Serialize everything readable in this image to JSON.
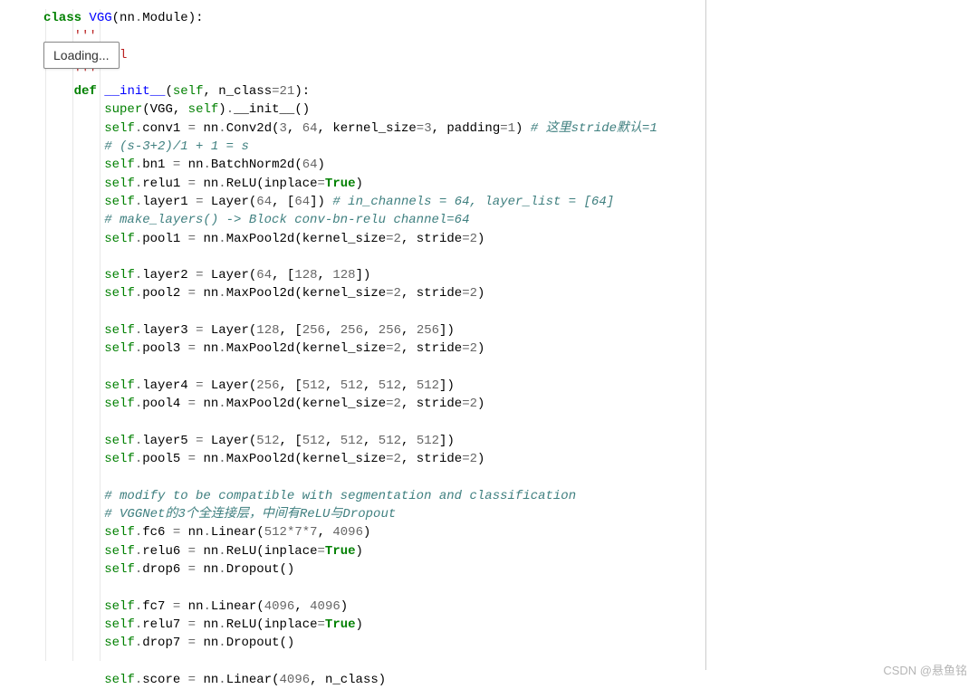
{
  "loading_label": "Loading...",
  "watermark": "CSDN @悬鱼铭",
  "code": {
    "class_kw": "class",
    "class_name": "VGG",
    "module_base": "nn",
    "module_cls": "Module",
    "docstring_open": "'''",
    "docstring_text": "del",
    "docstring_close": "'''",
    "def_kw": "def",
    "init_name": "__init__",
    "self": "self",
    "param_nclass": "n_class",
    "nclass_default": "21",
    "super_line_a": "super",
    "super_line_b": "VGG",
    "super_line_c": "self",
    "super_init": "__init__",
    "conv1_attr": "conv1",
    "nn": "nn",
    "Conv2d": "Conv2d",
    "c2d_a": "3",
    "c2d_b": "64",
    "ks_lbl": "kernel_size",
    "ks_v": "3",
    "pad_lbl": "padding",
    "pad_v": "1",
    "c1_comment": "# 这里stride默认=1",
    "c2_comment": "# (s-3+2)/1 + 1 = s",
    "bn1_attr": "bn1",
    "BatchNorm2d": "BatchNorm2d",
    "bn1_v": "64",
    "relu1_attr": "relu1",
    "ReLU": "ReLU",
    "inplace_lbl": "inplace",
    "true_kw": "True",
    "layer1_attr": "layer1",
    "Layer": "Layer",
    "l1_a": "64",
    "l1_b": "64",
    "l1_comment": "# in_channels = 64, layer_list = [64]",
    "ml_comment": "# make_layers() -> Block conv-bn-relu channel=64",
    "pool1_attr": "pool1",
    "MaxPool2d": "MaxPool2d",
    "p_ks_lbl": "kernel_size",
    "p_ks_v": "2",
    "stride_lbl": "stride",
    "stride_v": "2",
    "layer2_attr": "layer2",
    "l2_a": "64",
    "l2_b1": "128",
    "l2_b2": "128",
    "pool2_attr": "pool2",
    "layer3_attr": "layer3",
    "l3_a": "128",
    "l3_b1": "256",
    "l3_b2": "256",
    "l3_b3": "256",
    "l3_b4": "256",
    "pool3_attr": "pool3",
    "layer4_attr": "layer4",
    "l4_a": "256",
    "l4_b1": "512",
    "l4_b2": "512",
    "l4_b3": "512",
    "l4_b4": "512",
    "pool4_attr": "pool4",
    "layer5_attr": "layer5",
    "l5_a": "512",
    "l5_b1": "512",
    "l5_b2": "512",
    "l5_b3": "512",
    "l5_b4": "512",
    "pool5_attr": "pool5",
    "mod_comment": "# modify to be compatible with segmentation and classification",
    "vgg_comment": "# VGGNet的3个全连接层，中间有ReLU与Dropout",
    "fc6_attr": "fc6",
    "Linear": "Linear",
    "fc6_a": "512",
    "fc6_b": "7",
    "fc6_c": "7",
    "fc6_out": "4096",
    "relu6_attr": "relu6",
    "drop6_attr": "drop6",
    "Dropout": "Dropout",
    "fc7_attr": "fc7",
    "fc7_a": "4096",
    "fc7_b": "4096",
    "relu7_attr": "relu7",
    "drop7_attr": "drop7",
    "score_attr": "score",
    "score_a": "4096",
    "score_b": "n_class"
  }
}
